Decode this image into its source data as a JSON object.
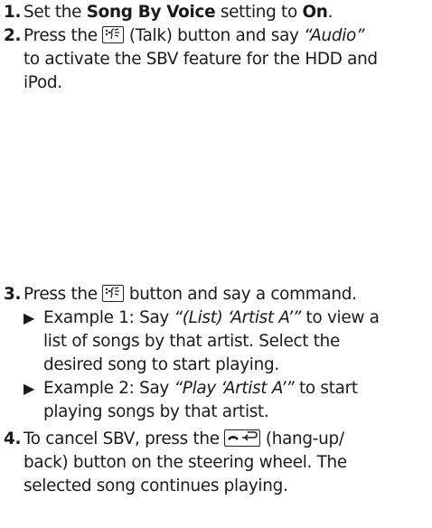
{
  "steps": {
    "s1": {
      "num": "1.",
      "pre": "Set the ",
      "b1": "Song By Voice",
      "mid": " setting to ",
      "b2": "On",
      "post": "."
    },
    "s2": {
      "num": "2.",
      "pre": "Press the ",
      "post1": " (Talk) button and say ",
      "it": "“Audio”",
      "line2": "to activate the SBV feature for the HDD and",
      "line3": "iPod."
    },
    "s3": {
      "num": "3.",
      "pre": "Press the ",
      "post": " button and say a command."
    },
    "e1": {
      "pre": "Example 1: Say ",
      "it": "“(List) ‘Artist A’”",
      "post": " to view a",
      "line2": "list of songs by that artist. Select the",
      "line3": "desired song to start playing."
    },
    "e2": {
      "pre": "Example 2: Say ",
      "it": "“Play ‘Artist A’”",
      "post": " to start",
      "line2": "playing songs by that artist."
    },
    "s4": {
      "num": "4.",
      "pre": "To cancel SBV, press the ",
      "post": " (hang-up/",
      "line2": "back) button on the steering wheel. The",
      "line3": "selected song continues playing."
    }
  },
  "icons": {
    "talk": "talk-icon",
    "hangup": "hang-up-back-icon",
    "arrow": "triangle-right-icon"
  },
  "colors": {
    "text": "#1a1a1a",
    "background": "#ffffff"
  }
}
